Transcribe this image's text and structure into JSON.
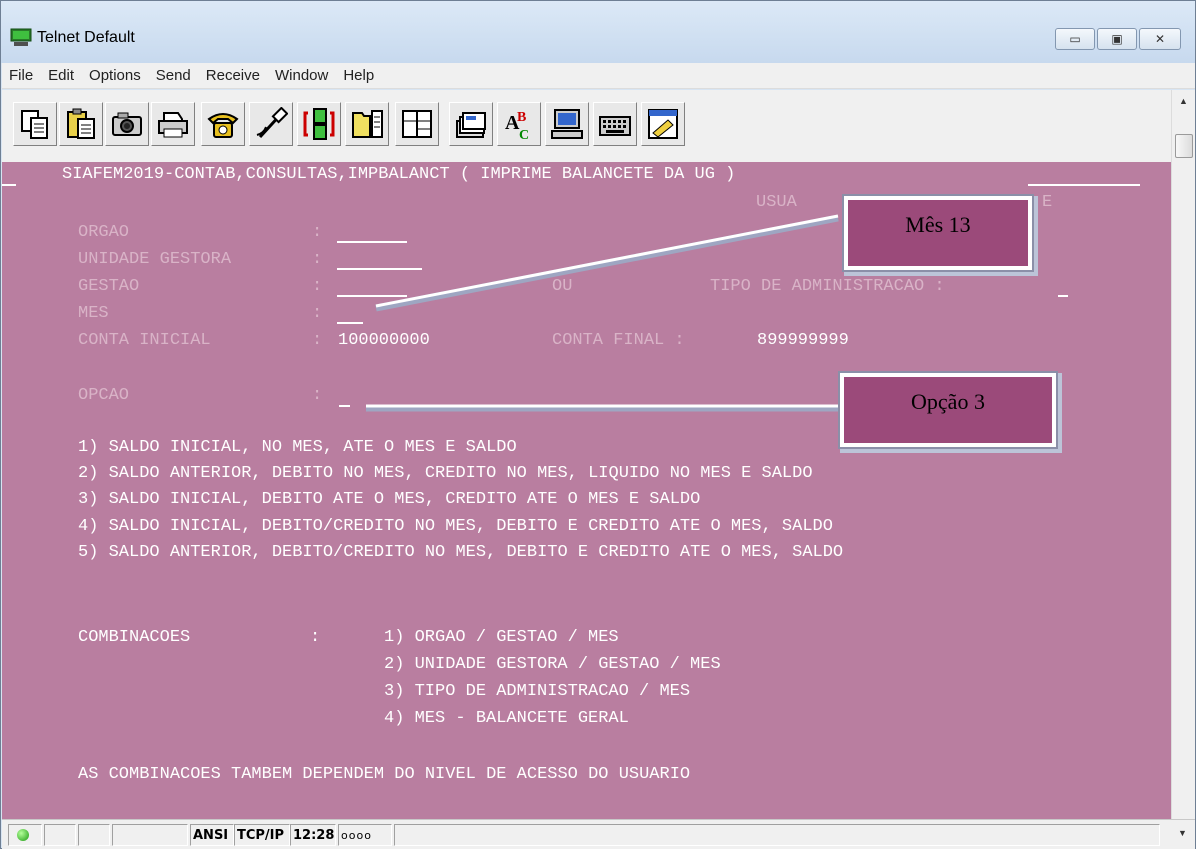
{
  "window": {
    "title": "Telnet Default",
    "buttons": {
      "minimize": "▭",
      "maximize": "▣",
      "close": "✕"
    }
  },
  "menu": [
    "File",
    "Edit",
    "Options",
    "Send",
    "Receive",
    "Window",
    "Help"
  ],
  "toolbar": {
    "icons": [
      "copy-icon",
      "paste-icon",
      "camera-icon",
      "print-icon",
      "phone-icon",
      "hangup-icon",
      "connect-icon",
      "file-transfer-icon",
      "session-icon",
      "font-icon",
      "terminal-icon",
      "keyboard-icon",
      "keymap-icon"
    ]
  },
  "terminal": {
    "header": "SIAFEM2019-CONTAB,CONSULTAS,IMPBALANCT ( IMPRIME BALANCETE DA UG )",
    "usuario_fragment_left": "USUA",
    "usuario_fragment_right": "E",
    "fields": {
      "orgao_label": "ORGAO",
      "unidade_label": "UNIDADE GESTORA",
      "gestao_label": "GESTAO",
      "ou_label": "OU",
      "tipo_adm_label": "TIPO DE ADMINISTRACAO :",
      "mes_label": "MES",
      "conta_inicial_label": "CONTA INICIAL",
      "conta_inicial_value": "100000000",
      "conta_final_label": "CONTA FINAL :",
      "conta_final_value": "899999999",
      "opcao_label": "OPCAO",
      "colon": ":"
    },
    "options": [
      "1) SALDO INICIAL, NO MES, ATE O MES E SALDO",
      "2) SALDO ANTERIOR, DEBITO NO MES, CREDITO NO MES, LIQUIDO NO MES E SALDO",
      "3) SALDO INICIAL, DEBITO ATE O MES, CREDITO ATE O MES E SALDO",
      "4) SALDO INICIAL, DEBITO/CREDITO NO MES, DEBITO E CREDITO ATE O MES, SALDO",
      "5) SALDO ANTERIOR, DEBITO/CREDITO NO MES, DEBITO E CREDITO ATE O MES, SALDO"
    ],
    "combinacoes_label": "COMBINACOES",
    "combinacoes": [
      "1) ORGAO / GESTAO / MES",
      "2) UNIDADE GESTORA / GESTAO / MES",
      "3) TIPO DE ADMINISTRACAO / MES",
      "4) MES - BALANCETE GERAL"
    ],
    "footer": "AS COMBINACOES TAMBEM DEPENDEM DO NIVEL DE ACESSO DO USUARIO"
  },
  "callouts": {
    "mes": "Mês 13",
    "opcao": "Opção 3"
  },
  "status": {
    "mode": "ANSI",
    "protocol": "TCP/IP",
    "time": "12:28",
    "indicator": "oooo"
  },
  "colors": {
    "terminal_bg": "#b97ea0",
    "callout_bg": "#9b4a7a",
    "text": "#ffffff"
  }
}
